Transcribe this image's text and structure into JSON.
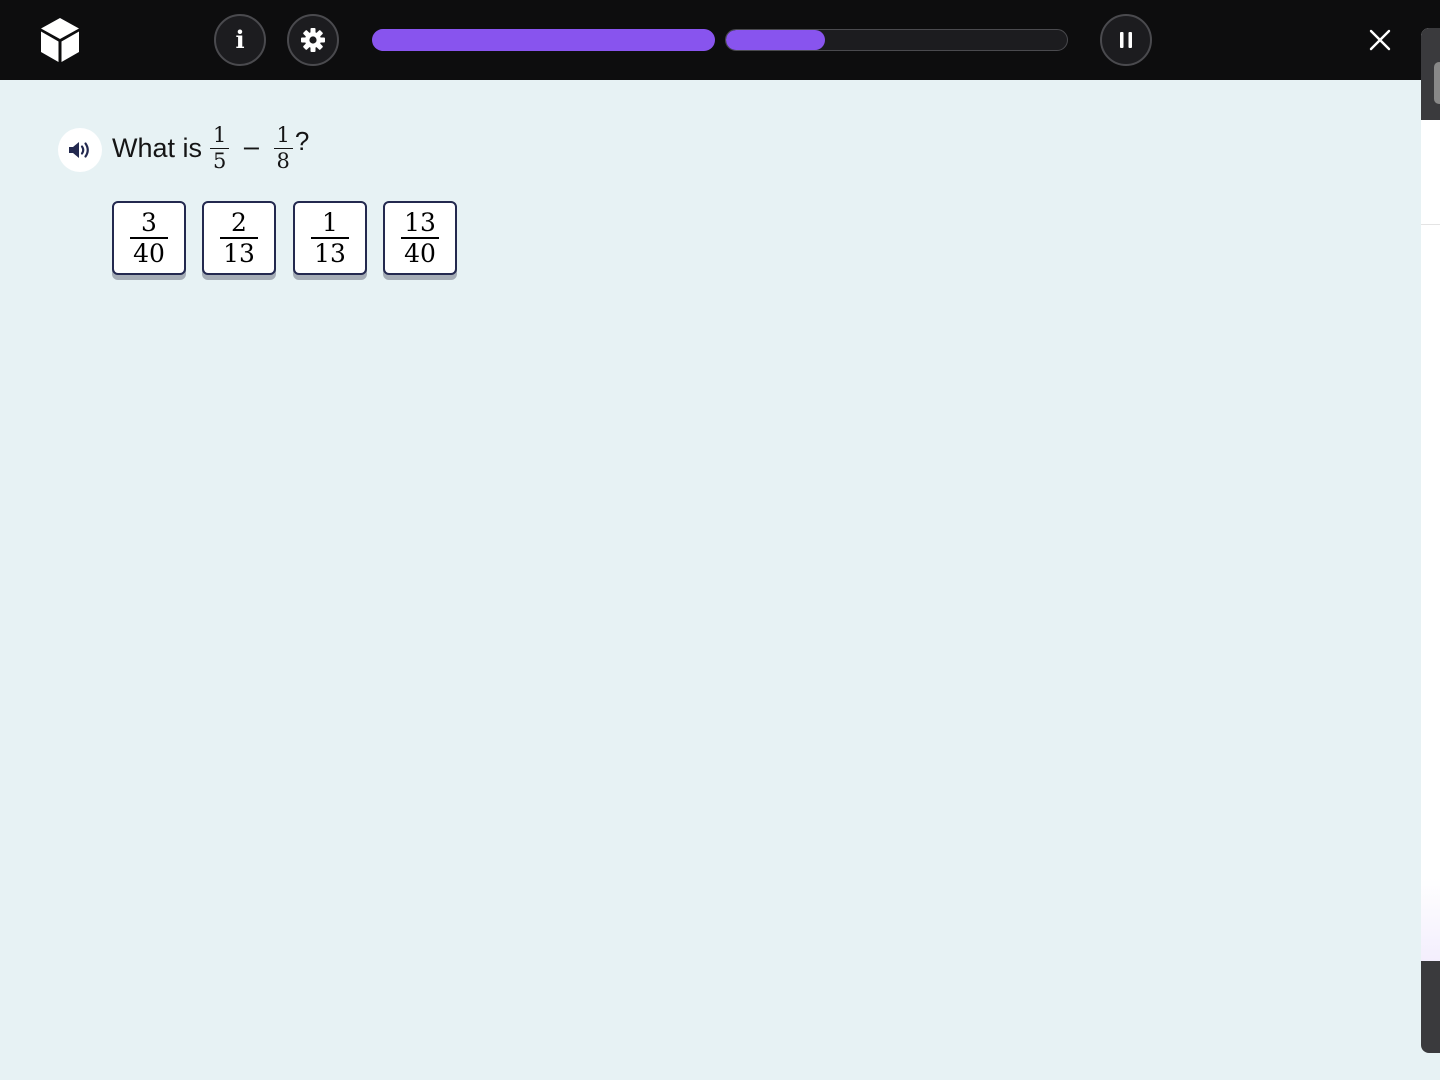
{
  "topbar": {
    "logo_icon": "cube-logo-icon",
    "info_label": "i",
    "settings_icon": "gear-icon",
    "pause_icon": "pause-icon",
    "close_icon": "close-icon",
    "progress": [
      {
        "name": "segment-1",
        "fraction": 1.0
      },
      {
        "name": "segment-2",
        "fraction": 0.29
      }
    ],
    "accent_color": "#8854ee"
  },
  "question": {
    "audio_icon": "speaker-icon",
    "prefix": "What is",
    "left_numerator": "1",
    "left_denominator": "5",
    "operator": "−",
    "right_numerator": "1",
    "right_denominator": "8",
    "suffix": "?"
  },
  "options": [
    {
      "numerator": "3",
      "denominator": "40"
    },
    {
      "numerator": "2",
      "denominator": "13"
    },
    {
      "numerator": "1",
      "denominator": "13"
    },
    {
      "numerator": "13",
      "denominator": "40"
    }
  ]
}
